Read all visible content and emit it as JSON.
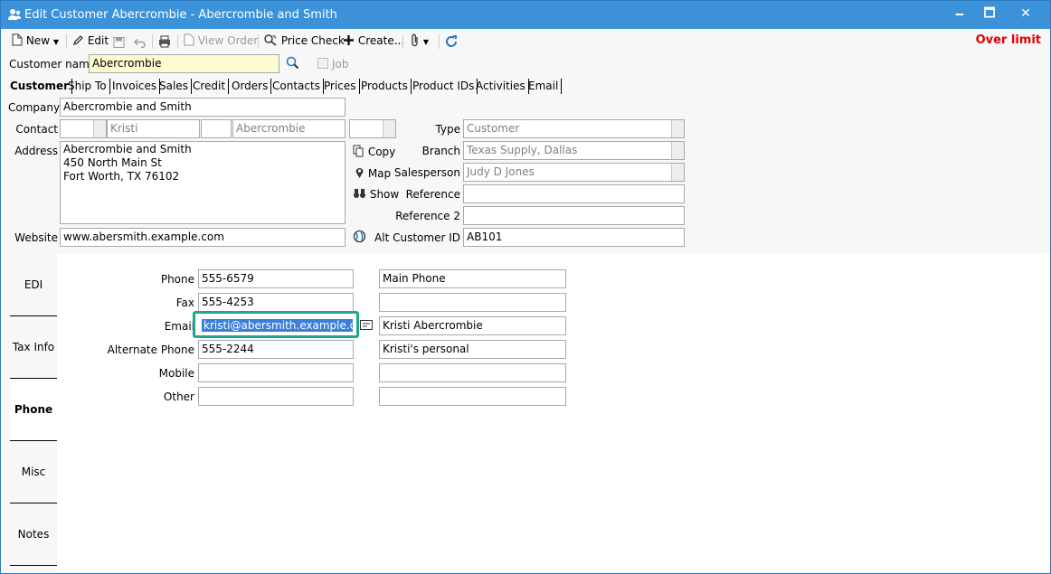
{
  "window": {
    "title": "Edit Customer Abercrombie - Abercrombie and Smith",
    "minimize": "🗕",
    "maximize": "🗖",
    "close": "✕"
  },
  "toolbar": {
    "new": "New",
    "edit": "Edit",
    "view_order": "View Order",
    "price_check": "Price Check",
    "create": "Create...",
    "over_limit": "Over limit"
  },
  "customer": {
    "name_label": "Customer name",
    "name_value": "Abercrombie",
    "job_label": "Job"
  },
  "tabs": [
    "Customer",
    "Ship To",
    "Invoices",
    "Sales",
    "Credit",
    "Orders",
    "Contacts",
    "Prices",
    "Products",
    "Product IDs",
    "Activities",
    "Email"
  ],
  "main": {
    "company_label": "Company",
    "company_value": "Abercrombie and Smith",
    "contact_label": "Contact",
    "contact_first": "Kristi",
    "contact_last": "Abercrombie",
    "address_label": "Address",
    "address_lines": [
      "Abercrombie and Smith",
      "450 North Main St",
      "Fort Worth, TX 76102"
    ],
    "copy_label": "Copy",
    "map_label": "Map",
    "show_label": "Show",
    "website_label": "Website",
    "website_value": "www.abersmith.example.com",
    "type_label": "Type",
    "type_value": "Customer",
    "branch_label": "Branch",
    "branch_value": "Texas Supply, Dallas",
    "salesperson_label": "Salesperson",
    "salesperson_value": "Judy D Jones",
    "reference_label": "Reference",
    "reference2_label": "Reference 2",
    "alt_id_label": "Alt Customer ID",
    "alt_id_value": "AB101"
  },
  "side_tabs": [
    "EDI",
    "Tax Info",
    "Phone",
    "Misc",
    "Notes"
  ],
  "phones": [
    {
      "label": "Phone",
      "value": "555-6579",
      "desc": "Main Phone"
    },
    {
      "label": "Fax",
      "value": "555-4253",
      "desc": ""
    },
    {
      "label": "Email",
      "value": "kristi@abersmith.example.com",
      "desc": "Kristi Abercrombie"
    },
    {
      "label": "Alternate Phone",
      "value": "555-2244",
      "desc": "Kristi's personal"
    },
    {
      "label": "Mobile",
      "value": "",
      "desc": ""
    },
    {
      "label": "Other",
      "value": "",
      "desc": ""
    }
  ],
  "colors": {
    "titlebar": "#3c92d8",
    "overlimit": "#e00000",
    "focus": "#20a58f",
    "selection": "#3b7fd8",
    "customer_name_bg": "#fdfbd2"
  }
}
